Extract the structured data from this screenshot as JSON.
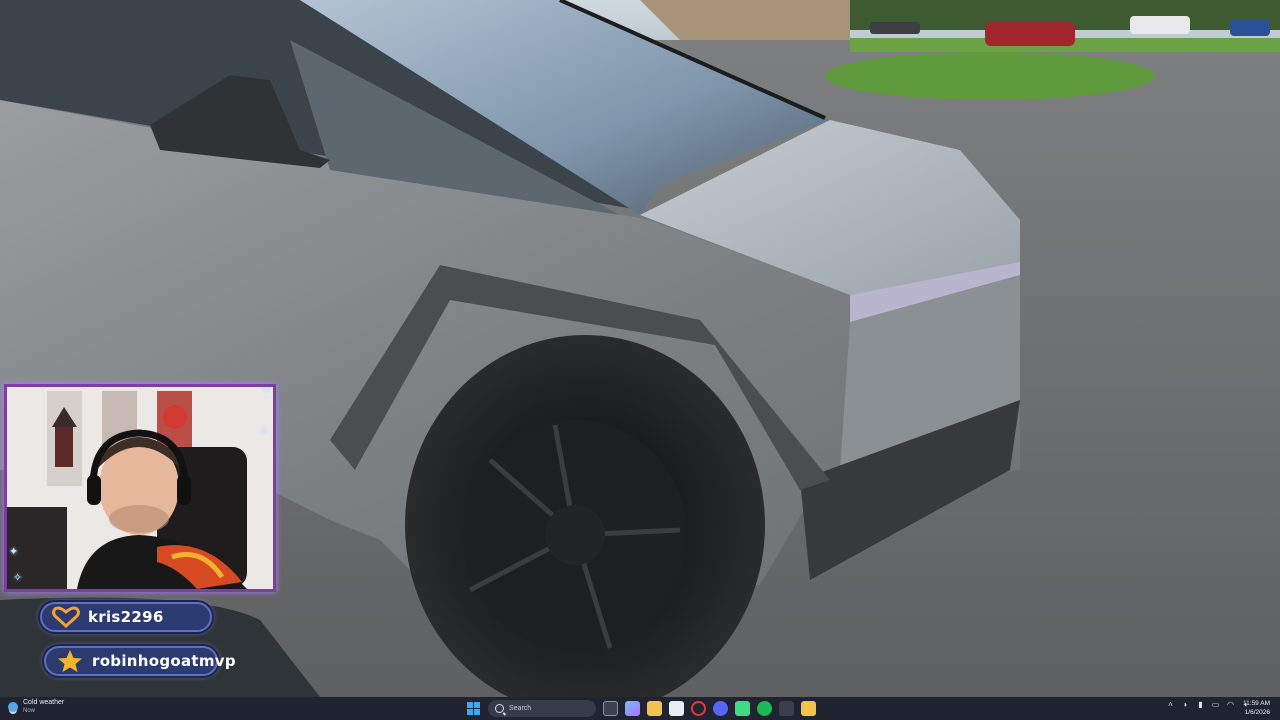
{
  "overlay": {
    "badges": [
      {
        "username": "kris2296",
        "icon": "heart-icon",
        "icon_color": "#f2a23a"
      },
      {
        "username": "robinhogoatmvp",
        "icon": "star-icon",
        "icon_color": "#f5b52a"
      }
    ],
    "frame_color": "#7b3fa3"
  },
  "taskbar": {
    "weather_title": "Cold weather",
    "weather_sub": "Now",
    "search_placeholder": "Search",
    "time": "11:59 AM",
    "date": "1/6/2026"
  },
  "colors": {
    "truck_body": "#8f9396",
    "asphalt": "#6d6f70",
    "grass": "#5f9a3c",
    "taskbar": "#1f2430",
    "badge_bg": "#2b3a6f"
  }
}
